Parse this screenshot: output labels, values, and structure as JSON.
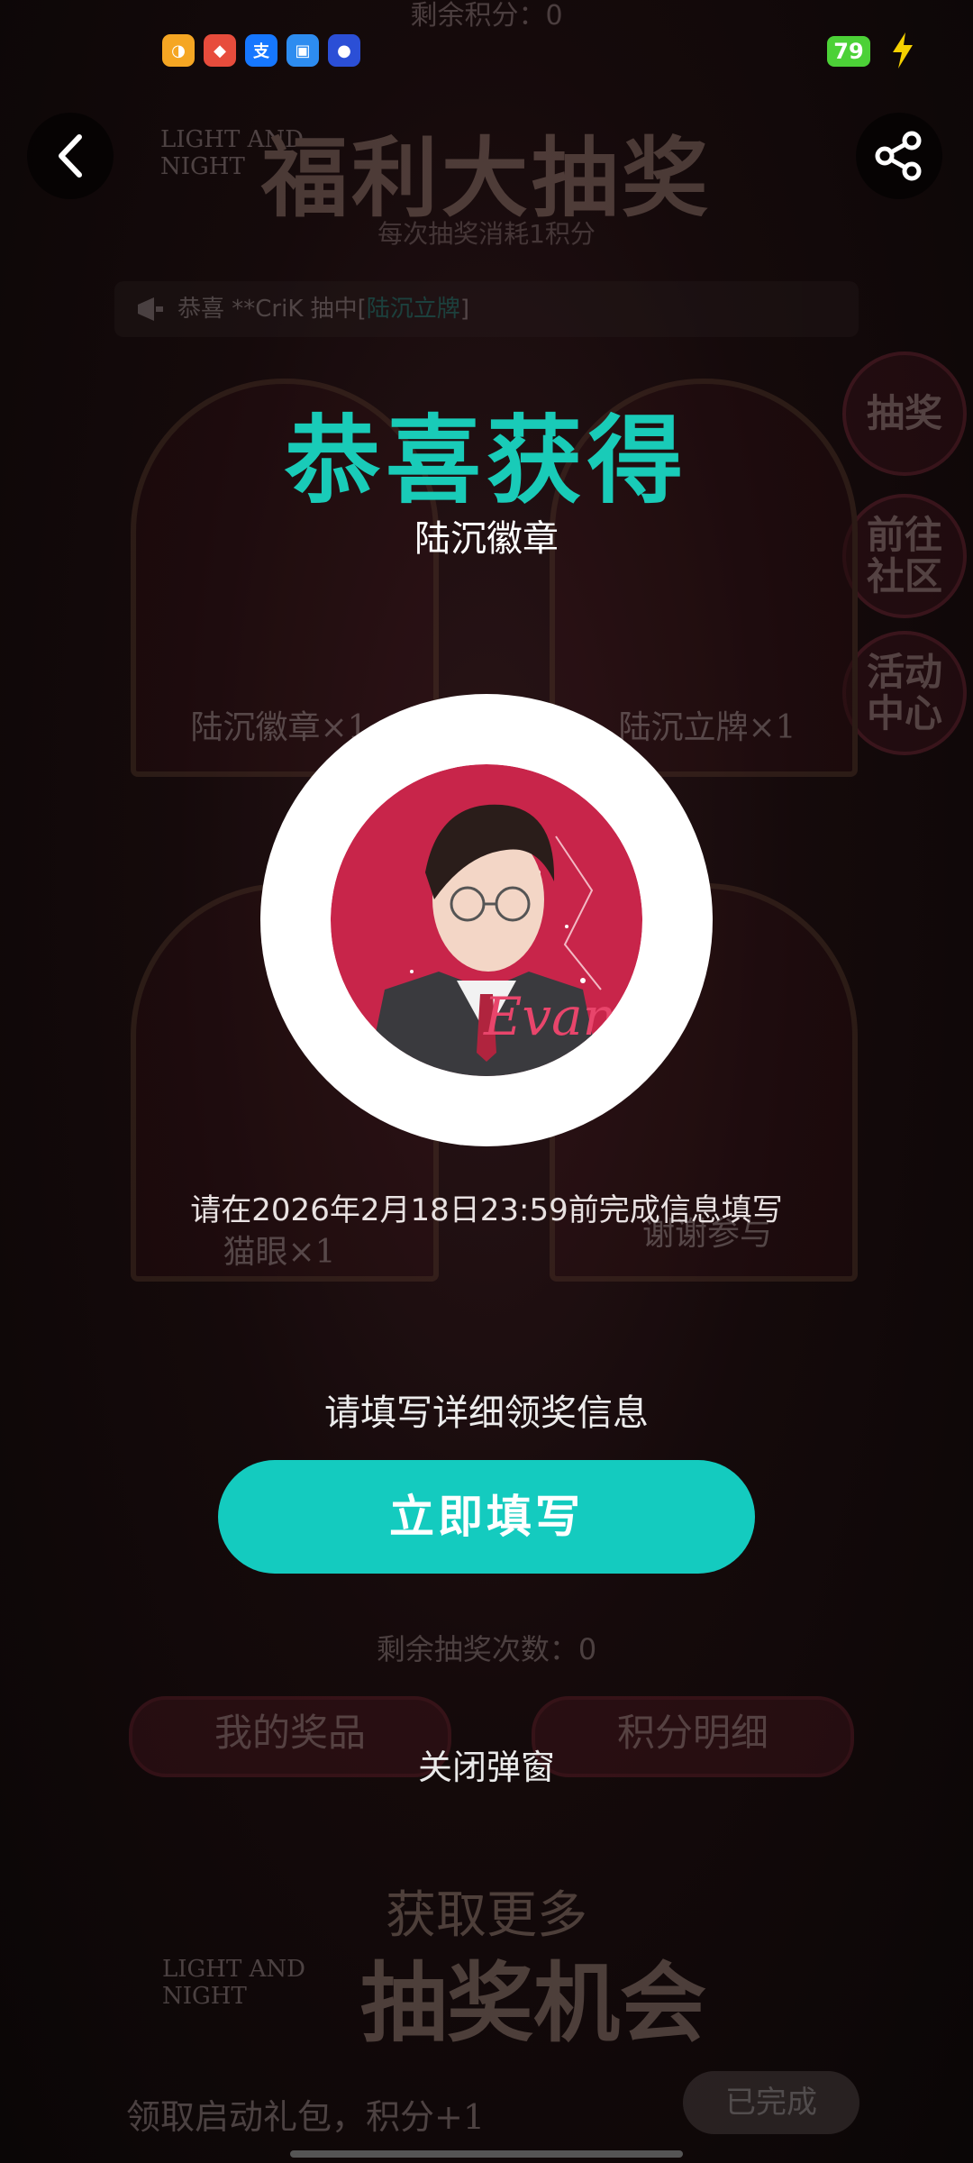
{
  "status_bar": {
    "battery": "79",
    "apps": [
      {
        "name": "shop-app",
        "color": "#f5a623",
        "glyph": "◑"
      },
      {
        "name": "bank-app",
        "color": "#e74c3c",
        "glyph": "◆"
      },
      {
        "name": "alipay-app",
        "color": "#1677ff",
        "glyph": "支"
      },
      {
        "name": "cloud-app",
        "color": "#2d8cf0",
        "glyph": "▣"
      },
      {
        "name": "game-app",
        "color": "#2b4fd6",
        "glyph": "●"
      }
    ]
  },
  "background": {
    "remaining_points": "剩余积分：0",
    "logo": [
      "LIGHT AND",
      "NIGHT"
    ],
    "title": "福利大抽奖",
    "subtitle": "每次抽奖消耗1积分",
    "marquee": {
      "prefix": "恭喜 **CriK 抽中[",
      "highlight": "陆沉立牌",
      "suffix": "]"
    },
    "side_buttons": [
      [
        "抽奖"
      ],
      [
        "前往",
        "社区"
      ],
      [
        "活动",
        "中心"
      ]
    ],
    "prizes": [
      {
        "label": "陆沉徽章×1"
      },
      {
        "label": "陆沉立牌×1"
      },
      {
        "label": "猫眼×1"
      },
      {
        "label": "谢谢参与"
      }
    ],
    "remaining_draws": "剩余抽奖次数：0",
    "my_prizes": "我的奖品",
    "points_detail": "积分明细",
    "more_title": "获取更多",
    "more_title2": "抽奖机会",
    "task": {
      "text": "领取启动礼包，积分+1",
      "status": "已完成"
    }
  },
  "modal": {
    "title": "恭喜获得",
    "prize_name": "陆沉徽章",
    "deadline": "请在2026年2月18日23:59前完成信息填写",
    "fill_hint": "请填写详细领奖信息",
    "fill_button": "立即填写",
    "close_link": "关闭弹窗"
  },
  "colors": {
    "accent": "#14cbbf",
    "badge_red": "#c8254a"
  }
}
